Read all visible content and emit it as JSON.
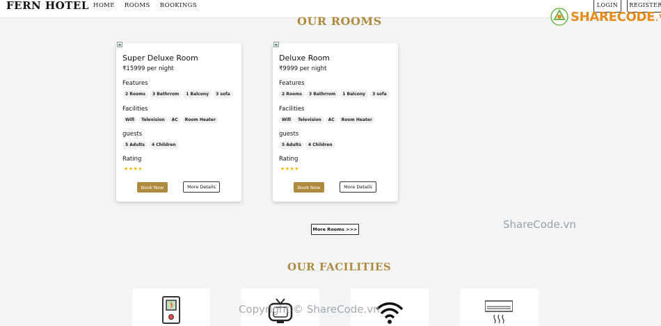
{
  "nav": {
    "brand": "FERN HOTEL",
    "links": [
      "Home",
      "Rooms",
      "Bookings"
    ],
    "login": "Login",
    "register": "Register"
  },
  "watermark": {
    "logo_text": "SHARECODE",
    "logo_suffix": ".vn",
    "mid": "ShareCode.vn",
    "copyright": "Copyright © ShareCode.vn"
  },
  "rooms_title": "OUR ROOMS",
  "rooms": [
    {
      "name": "Super Deluxe Room",
      "price": "₹15999 per night",
      "features_label": "Features",
      "features": [
        "2 Rooms",
        "3 Bathrrom",
        "1 Balcony",
        "3 sofa"
      ],
      "facilities_label": "Facilities",
      "facilities": [
        "Wifi",
        "Television",
        "AC",
        "Room Heater"
      ],
      "guests_label": "guests",
      "guests": [
        "5 Adults",
        "4 Children"
      ],
      "rating_label": "Rating",
      "rating": "★★★★",
      "book": "Book Now",
      "details": "More Details"
    },
    {
      "name": "Deluxe Room",
      "price": "₹9999 per night",
      "features_label": "Features",
      "features": [
        "2 Rooms",
        "3 Bathrrom",
        "1 Balcony",
        "3 sofa"
      ],
      "facilities_label": "Facilities",
      "facilities": [
        "Wifi",
        "Television",
        "AC",
        "Room Heater"
      ],
      "guests_label": "guests",
      "guests": [
        "5 Adults",
        "4 Children"
      ],
      "rating_label": "Rating",
      "rating": "★★★★",
      "book": "Book Now",
      "details": "More Details"
    }
  ],
  "more_rooms": "More Rooms >>>",
  "facilities_title": "OUR FACILITIES",
  "facility_icons": [
    "room-heater-icon",
    "television-icon",
    "wifi-icon",
    "ac-icon"
  ],
  "colors": {
    "accent": "#b08a3e",
    "star": "#f0b400",
    "watermark": "#e58b1a"
  }
}
